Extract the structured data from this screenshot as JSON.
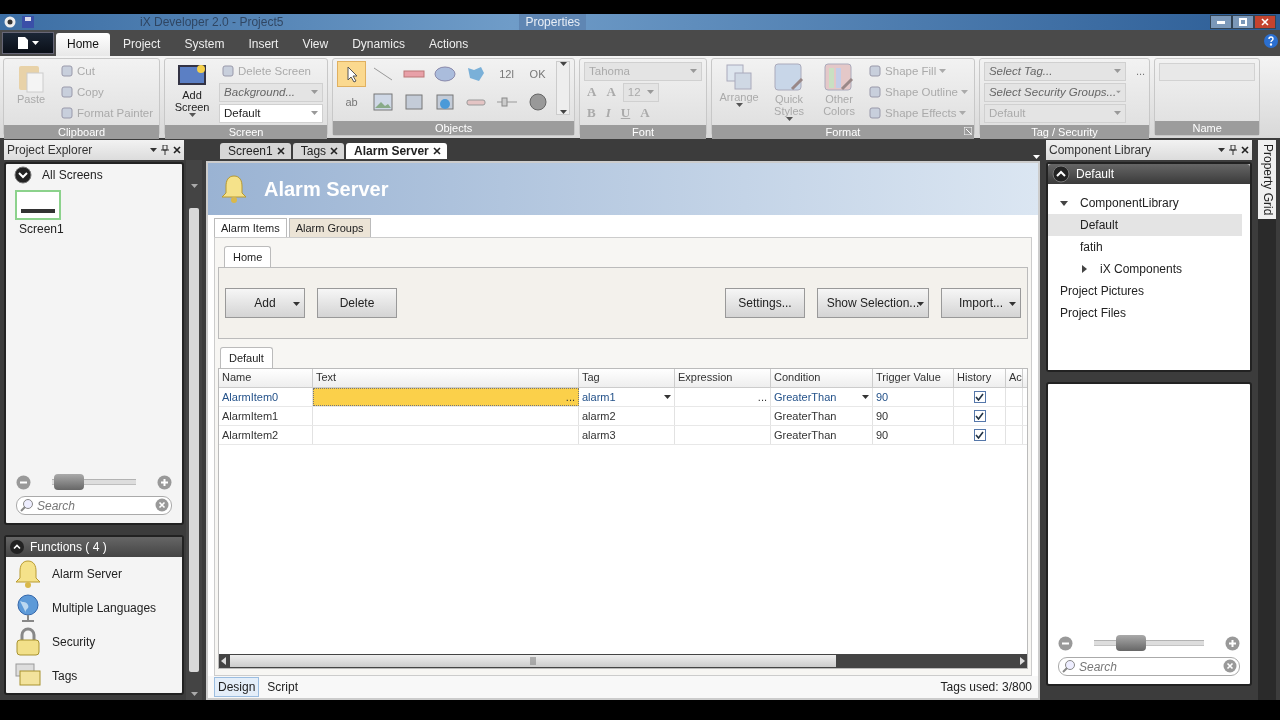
{
  "window": {
    "title": "iX Developer 2.0 - Project5",
    "context_tab": "Properties"
  },
  "menu_tabs": [
    {
      "label": "Home",
      "selected": true
    },
    {
      "label": "Project",
      "selected": false
    },
    {
      "label": "System",
      "selected": false
    },
    {
      "label": "Insert",
      "selected": false
    },
    {
      "label": "View",
      "selected": false
    },
    {
      "label": "Dynamics",
      "selected": false
    },
    {
      "label": "Actions",
      "selected": false
    }
  ],
  "ribbon": [
    {
      "title": "Clipboard",
      "items": [
        {
          "kind": "large",
          "label": "Paste",
          "disabled": true
        },
        {
          "kind": "small",
          "label": "Cut",
          "disabled": true
        },
        {
          "kind": "small",
          "label": "Copy",
          "disabled": true
        },
        {
          "kind": "small",
          "label": "Format Painter",
          "disabled": true
        }
      ]
    },
    {
      "title": "Screen",
      "items": [
        {
          "kind": "large",
          "label": "Add Screen",
          "dropdown": true,
          "disabled": false
        },
        {
          "kind": "small",
          "label": "Delete Screen",
          "disabled": true
        },
        {
          "kind": "dropdown",
          "placeholder": "Background...",
          "disabled": true
        },
        {
          "kind": "dropdown",
          "value": "Default",
          "disabled": false
        }
      ]
    },
    {
      "title": "Objects",
      "items": [
        {
          "kind": "tool",
          "selected": true
        },
        {
          "kind": "tool",
          "selected": false
        },
        {
          "kind": "tool",
          "selected": false
        },
        {
          "kind": "tool",
          "selected": false
        },
        {
          "kind": "tool",
          "selected": false
        },
        {
          "kind": "tool",
          "selected": false,
          "label": "12l"
        },
        {
          "kind": "tool",
          "selected": false,
          "label": "OK"
        },
        {
          "kind": "tool",
          "selected": false,
          "label": "ab"
        },
        {
          "kind": "tool",
          "selected": false
        },
        {
          "kind": "tool",
          "selected": false
        },
        {
          "kind": "tool",
          "selected": false
        },
        {
          "kind": "tool",
          "selected": false
        },
        {
          "kind": "tool",
          "selected": false
        },
        {
          "kind": "tool",
          "selected": false
        }
      ]
    },
    {
      "title": "Font",
      "items": [
        {
          "kind": "dropdown",
          "value": "Tahoma",
          "disabled": true
        },
        {
          "kind": "row",
          "buttons": [
            "A",
            "A"
          ],
          "value": "12",
          "disabled": true
        },
        {
          "kind": "row",
          "buttons": [
            "B",
            "I",
            "U",
            "A"
          ],
          "disabled": true
        }
      ]
    },
    {
      "title": "Format",
      "launcher": true,
      "items": [
        {
          "kind": "large",
          "label": "Arrange",
          "dropdown": true,
          "disabled": true
        },
        {
          "kind": "large",
          "label": "Quick Styles",
          "dropdown": true,
          "disabled": true
        },
        {
          "kind": "large",
          "label": "Other Colors",
          "disabled": true
        },
        {
          "kind": "small",
          "label": "Shape Fill",
          "dropdown": true,
          "disabled": true
        },
        {
          "kind": "small",
          "label": "Shape Outline",
          "dropdown": true,
          "disabled": true
        },
        {
          "kind": "small",
          "label": "Shape Effects",
          "dropdown": true,
          "disabled": true
        }
      ]
    },
    {
      "title": "Tag / Security",
      "items": [
        {
          "kind": "dropdown",
          "placeholder": "Select Tag...",
          "extra": "...",
          "disabled": true
        },
        {
          "kind": "dropdown",
          "placeholder": "Select Security Groups...",
          "disabled": true
        },
        {
          "kind": "dropdown",
          "value": "Default",
          "disabled": true
        }
      ]
    },
    {
      "title": "Name",
      "items": [
        {
          "kind": "field",
          "disabled": true
        }
      ]
    }
  ],
  "explorer": {
    "title": "Project Explorer",
    "section": "All Screens",
    "screens": [
      {
        "label": "Screen1",
        "selected": true
      }
    ],
    "zoom": {
      "level": 0.2
    },
    "search": {
      "placeholder": "Search"
    },
    "functions": {
      "title": "Functions ( 4 )",
      "items": [
        "Alarm Server",
        "Multiple Languages",
        "Security",
        "Tags"
      ]
    }
  },
  "doc_tabs": [
    {
      "label": "Screen1",
      "selected": false
    },
    {
      "label": "Tags",
      "selected": false
    },
    {
      "label": "Alarm Server",
      "selected": true
    }
  ],
  "alarm_server": {
    "title": "Alarm Server",
    "tabs": [
      {
        "label": "Alarm Items",
        "selected": true
      },
      {
        "label": "Alarm Groups",
        "selected": false
      }
    ],
    "toolbar_tab": "Home",
    "left_buttons": [
      {
        "label": "Add",
        "dropdown": true
      },
      {
        "label": "Delete",
        "dropdown": false
      }
    ],
    "right_buttons": [
      {
        "label": "Settings...",
        "dropdown": false
      },
      {
        "label": "Show Selection...",
        "dropdown": true
      },
      {
        "label": "Import...",
        "dropdown": true
      }
    ],
    "grid_tab": "Default",
    "columns": [
      "Name",
      "Text",
      "Tag",
      "Expression",
      "Condition",
      "Trigger Value",
      "History",
      "Ac"
    ],
    "rows": [
      {
        "name": "AlarmItem0",
        "text": "",
        "tag": "alarm1",
        "expression": "",
        "condition": "GreaterThan",
        "trigger": "90",
        "history": true,
        "selected": true
      },
      {
        "name": "AlarmItem1",
        "text": "",
        "tag": "alarm2",
        "expression": "",
        "condition": "GreaterThan",
        "trigger": "90",
        "history": true,
        "selected": false
      },
      {
        "name": "AlarmItem2",
        "text": "",
        "tag": "alarm3",
        "expression": "",
        "condition": "GreaterThan",
        "trigger": "90",
        "history": true,
        "selected": false
      }
    ],
    "editor_button": "...",
    "view_tabs": [
      {
        "label": "Design",
        "selected": true
      },
      {
        "label": "Script",
        "selected": false
      }
    ],
    "status": "Tags used: 3/800"
  },
  "library": {
    "title": "Component Library",
    "section": "Default",
    "tree": [
      {
        "label": "ComponentLibrary",
        "expanded": true,
        "selected": false,
        "children": [
          {
            "label": "Default",
            "selected": true
          },
          {
            "label": "fatih",
            "selected": false
          },
          {
            "label": "iX Components",
            "expanded": false,
            "selected": false
          }
        ]
      },
      {
        "label": "Project Pictures",
        "selected": false
      },
      {
        "label": "Project Files",
        "selected": false
      }
    ],
    "zoom": {
      "level": 0.34
    },
    "search": {
      "placeholder": "Search"
    }
  },
  "side_tab": "Property Grid"
}
